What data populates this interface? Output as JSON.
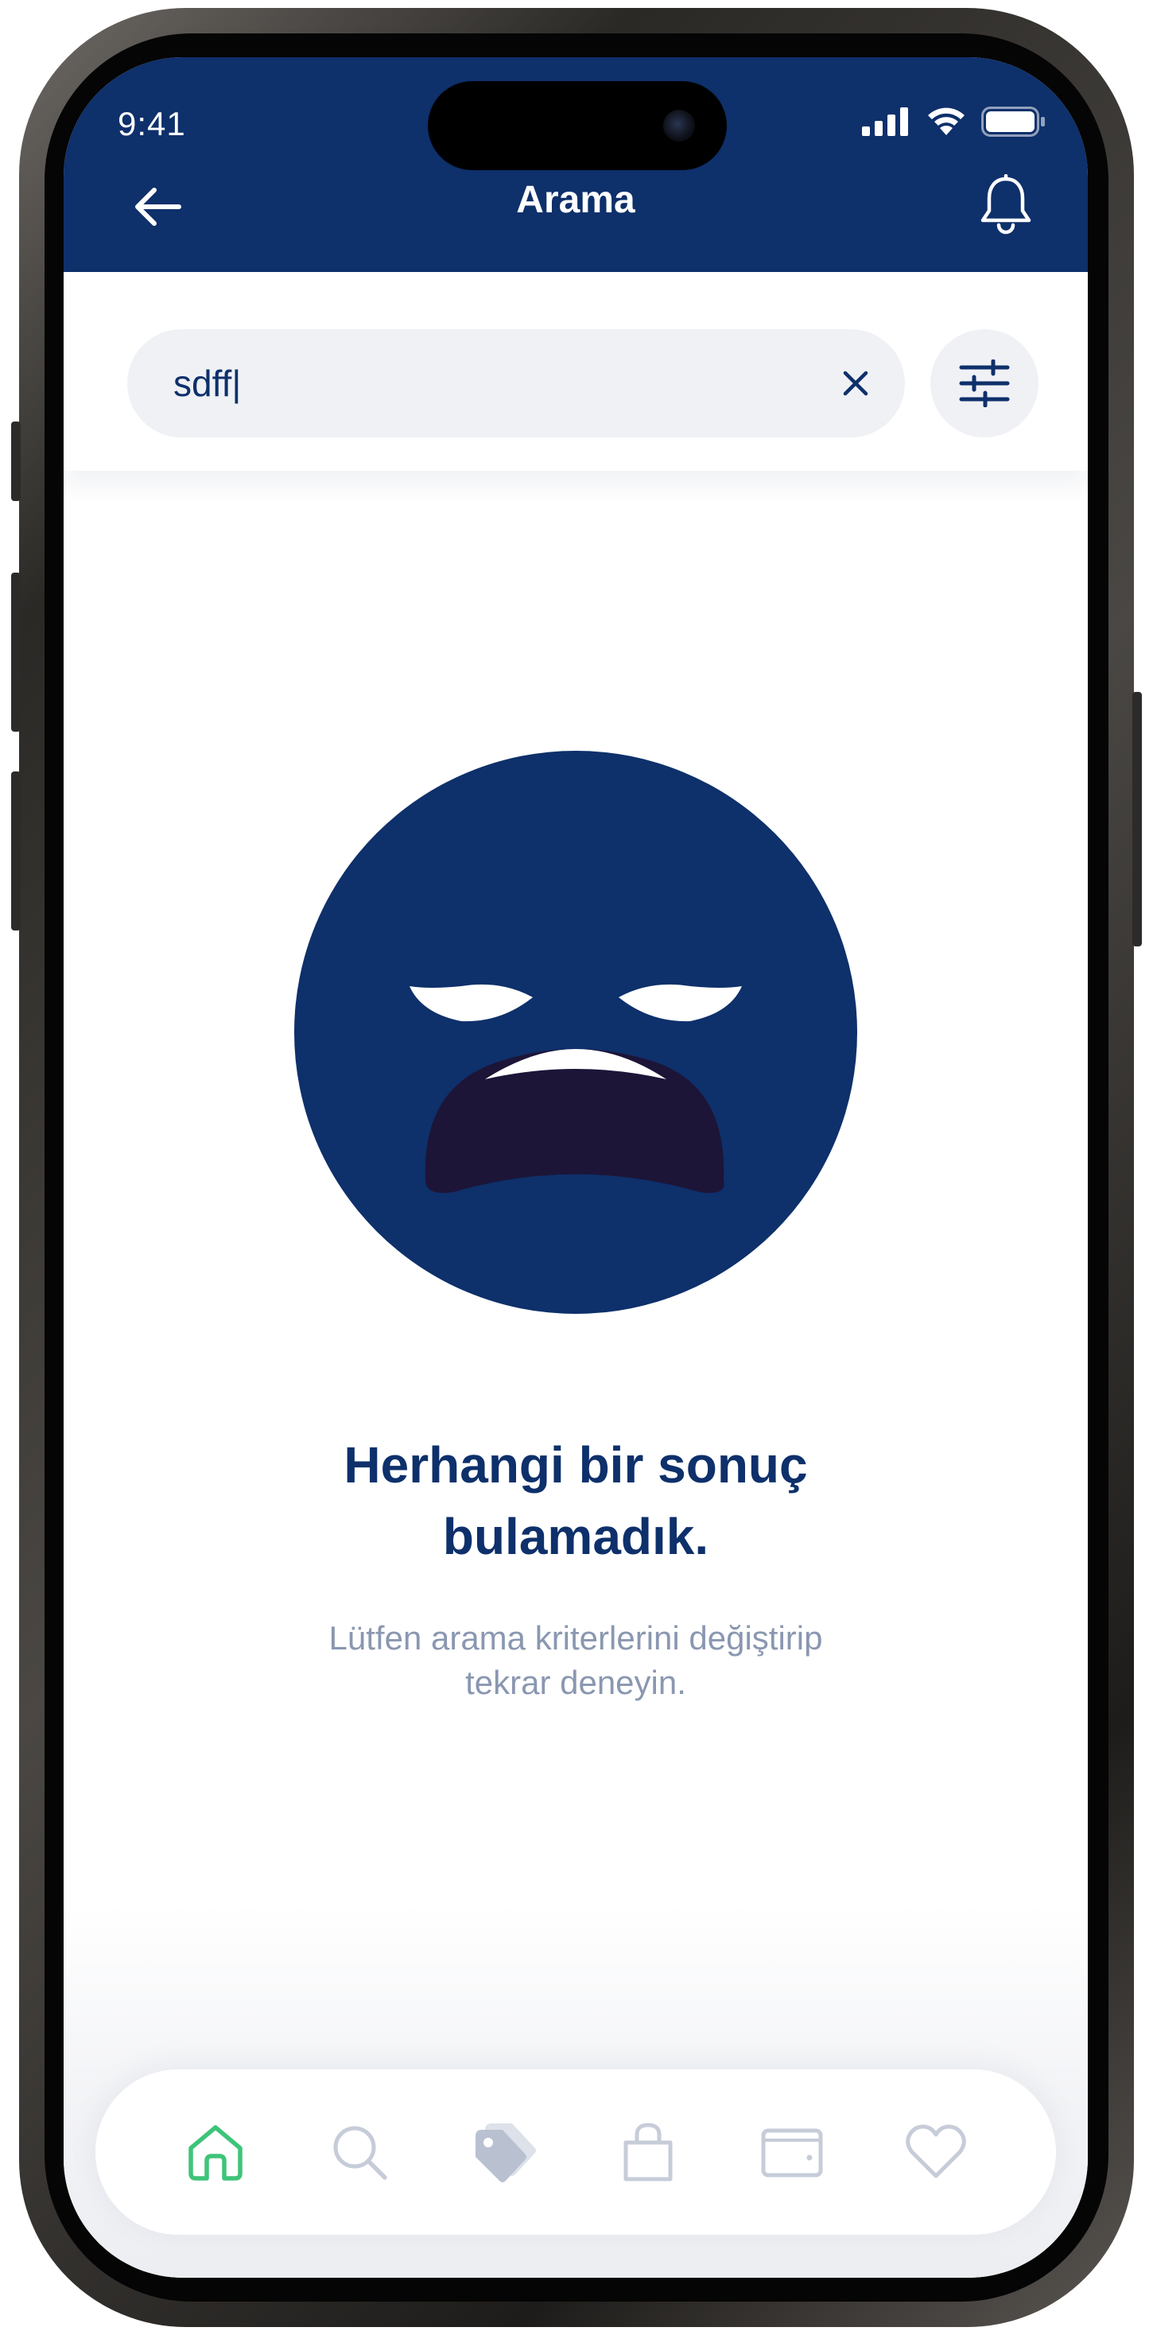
{
  "status_bar": {
    "time": "9:41"
  },
  "header": {
    "title": "Arama",
    "back_icon": "arrow-left-icon",
    "notification_icon": "bell-icon"
  },
  "search": {
    "value": "sdff|",
    "clear_icon": "close-icon",
    "filter_icon": "sliders-icon"
  },
  "empty_state": {
    "title_line1": "Herhangi bir sonuç",
    "title_line2": "bulamadık.",
    "subtitle_line1": "Lütfen arama kriterlerini değiştirip",
    "subtitle_line2": "tekrar deneyin.",
    "illustration": "tired-face-emoji"
  },
  "tabbar": {
    "items": [
      {
        "icon": "home-icon",
        "active": true
      },
      {
        "icon": "search-icon",
        "active": false
      },
      {
        "icon": "tag-icon",
        "active": false
      },
      {
        "icon": "shopping-bag-icon",
        "active": false
      },
      {
        "icon": "wallet-icon",
        "active": false
      },
      {
        "icon": "heart-icon",
        "active": false
      }
    ]
  },
  "colors": {
    "brand_navy": "#0e306b",
    "active_tab": "#3ec47a",
    "inactive_tab": "#c6ccd8",
    "search_bg": "#eff1f5",
    "subtitle": "#8a97b1"
  }
}
